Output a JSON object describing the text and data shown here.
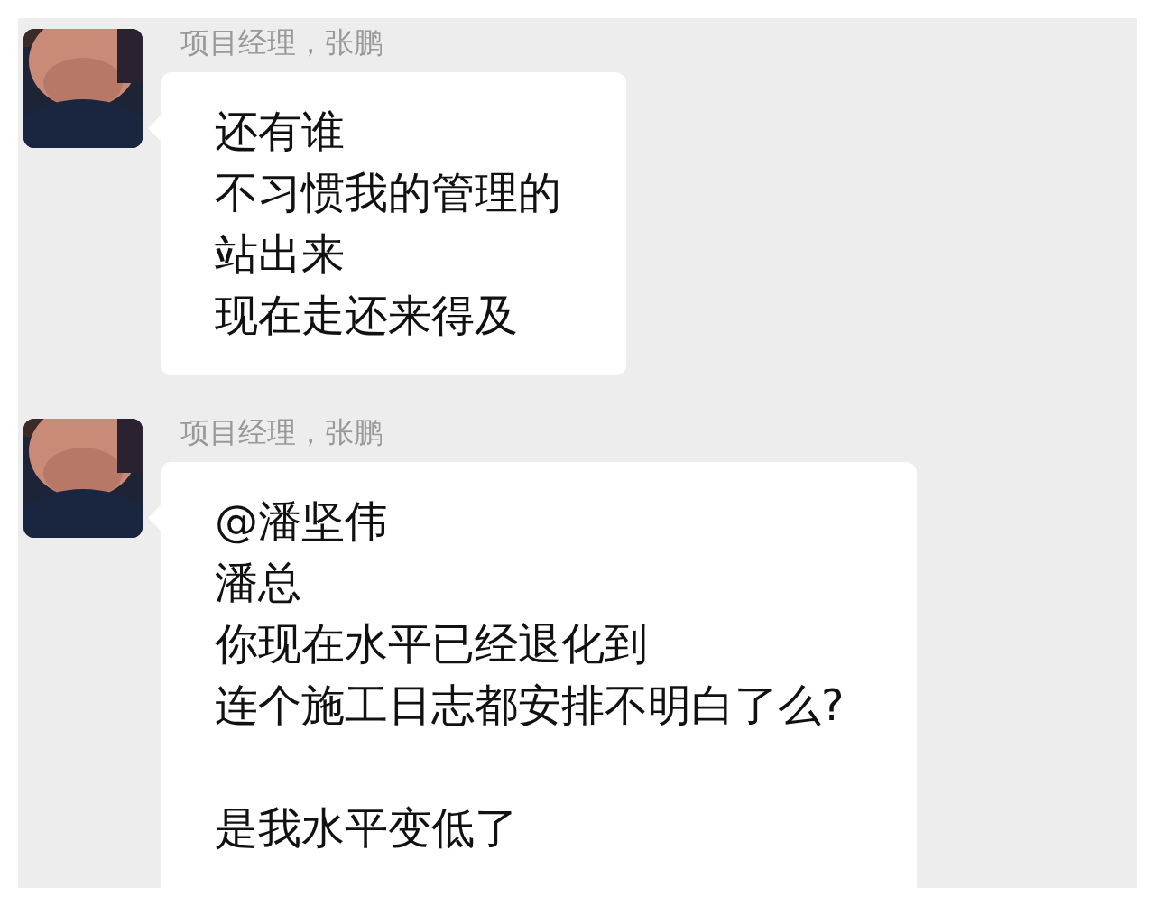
{
  "messages": [
    {
      "sender": "项目经理，张鹏",
      "avatar": {
        "kind": "picture"
      },
      "paragraphs": [
        [
          "还有谁",
          "不习惯我的管理的",
          "站出来",
          "现在走还来得及"
        ]
      ]
    },
    {
      "sender": "项目经理，张鹏",
      "avatar": {
        "kind": "picture"
      },
      "paragraphs": [
        [
          "@潘坚伟",
          "潘总",
          "你现在水平已经退化到",
          "连个施工日志都安排不明白了么?"
        ],
        [
          "是我水平变低了"
        ]
      ]
    }
  ]
}
